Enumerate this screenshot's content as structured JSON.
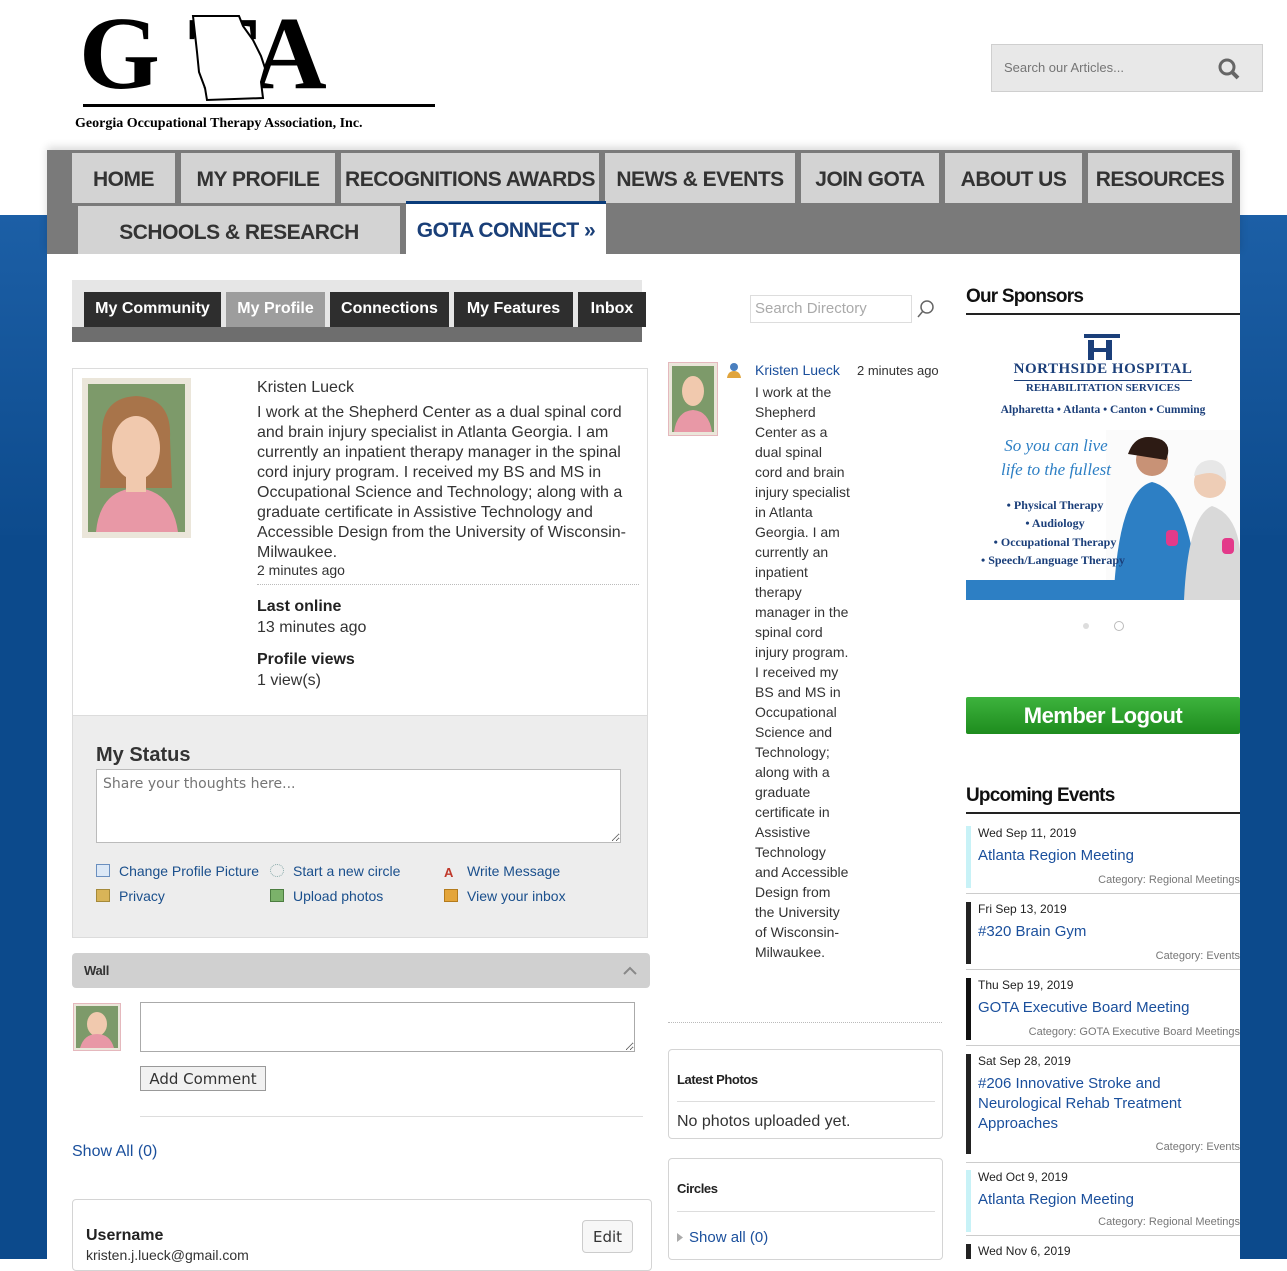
{
  "header": {
    "logo_letters": "G TA",
    "logo_tagline": "Georgia Occupational Therapy Association, Inc.",
    "search_placeholder": "Search our Articles..."
  },
  "nav": {
    "row1": [
      "HOME",
      "MY PROFILE",
      "RECOGNITIONS AWARDS",
      "NEWS & EVENTS",
      "JOIN GOTA",
      "ABOUT US",
      "RESOURCES"
    ],
    "row2": [
      "SCHOOLS & RESEARCH PROJECTS",
      "GOTA CONNECT »"
    ],
    "active": "GOTA CONNECT »"
  },
  "subnav": {
    "tabs": [
      "My Community",
      "My Profile",
      "Connections",
      "My Features",
      "Inbox"
    ],
    "active": "My Profile",
    "search_placeholder": "Search Directory"
  },
  "profile": {
    "name": "Kristen Lueck",
    "bio": "I work at the Shepherd Center as a dual spinal cord and brain injury specialist in Atlanta Georgia. I am currently an inpatient therapy manager in the spinal cord injury program. I received my BS and MS in Occupational Science and Technology; along with a graduate certificate in Assistive Technology and Accessible Design from the University of Wisconsin-Milwaukee.",
    "bio_time": "2 minutes ago",
    "last_online_label": "Last online",
    "last_online_value": "13 minutes ago",
    "views_label": "Profile views",
    "views_value": "1 view(s)"
  },
  "status": {
    "heading": "My Status",
    "placeholder": "Share your thoughts here...",
    "actions": [
      "Change Profile Picture",
      "Start a new circle",
      "Write Message",
      "Privacy",
      "Upload photos",
      "View your inbox"
    ]
  },
  "wall": {
    "title": "Wall",
    "add_comment": "Add Comment",
    "show_all": "Show All (0)"
  },
  "account": {
    "username_label": "Username",
    "username_value": "kristen.j.lueck@gmail.com",
    "edit": "Edit"
  },
  "activity": {
    "name": "Kristen Lueck",
    "time": "2 minutes ago",
    "text": "I work at the Shepherd Center as a dual spinal cord and brain injury specialist in Atlanta Georgia. I am currently an inpatient therapy manager in the spinal cord injury program. I received my BS and MS in Occupational Science and Technology; along with a graduate certificate in Assistive Technology and Accessible Design from the University of Wisconsin-Milwaukee."
  },
  "latest_photos": {
    "title": "Latest Photos",
    "empty": "No photos uploaded yet."
  },
  "circles": {
    "title": "Circles",
    "show_all": "Show all (0)"
  },
  "sidebar": {
    "sponsors_title": "Our Sponsors",
    "sponsor": {
      "name_line1": "NORTHSIDE HOSPITAL",
      "name_line2": "REHABILITATION SERVICES",
      "cities": "Alpharetta • Atlanta • Canton • Cumming",
      "slogan1": "So you can live",
      "slogan2": "life to the fullest",
      "services": [
        "• Physical Therapy",
        "• Audiology",
        "• Occupational Therapy",
        "• Speech/Language Therapy"
      ]
    },
    "logout": "Member Logout",
    "events_title": "Upcoming Events",
    "events": [
      {
        "date": "Wed Sep 11, 2019",
        "title": "Atlanta Region Meeting",
        "category": "Category: Regional Meetings",
        "color": "#c8f2f7"
      },
      {
        "date": "Fri Sep 13, 2019",
        "title": "#320 Brain Gym",
        "category": "Category: Events",
        "color": "#222222"
      },
      {
        "date": "Thu Sep 19, 2019",
        "title": "GOTA Executive Board Meeting",
        "category": "Category: GOTA Executive Board Meetings",
        "color": "#111111"
      },
      {
        "date": "Sat Sep 28, 2019",
        "title": "#206 Innovative Stroke and Neurological Rehab Treatment Approaches",
        "category": "Category: Events",
        "color": "#222222"
      },
      {
        "date": "Wed Oct 9, 2019",
        "title": "Atlanta Region Meeting",
        "category": "Category: Regional Meetings",
        "color": "#c8f2f7"
      },
      {
        "date": "Wed Nov 6, 2019",
        "title": "",
        "category": "",
        "color": "#222222"
      }
    ]
  }
}
